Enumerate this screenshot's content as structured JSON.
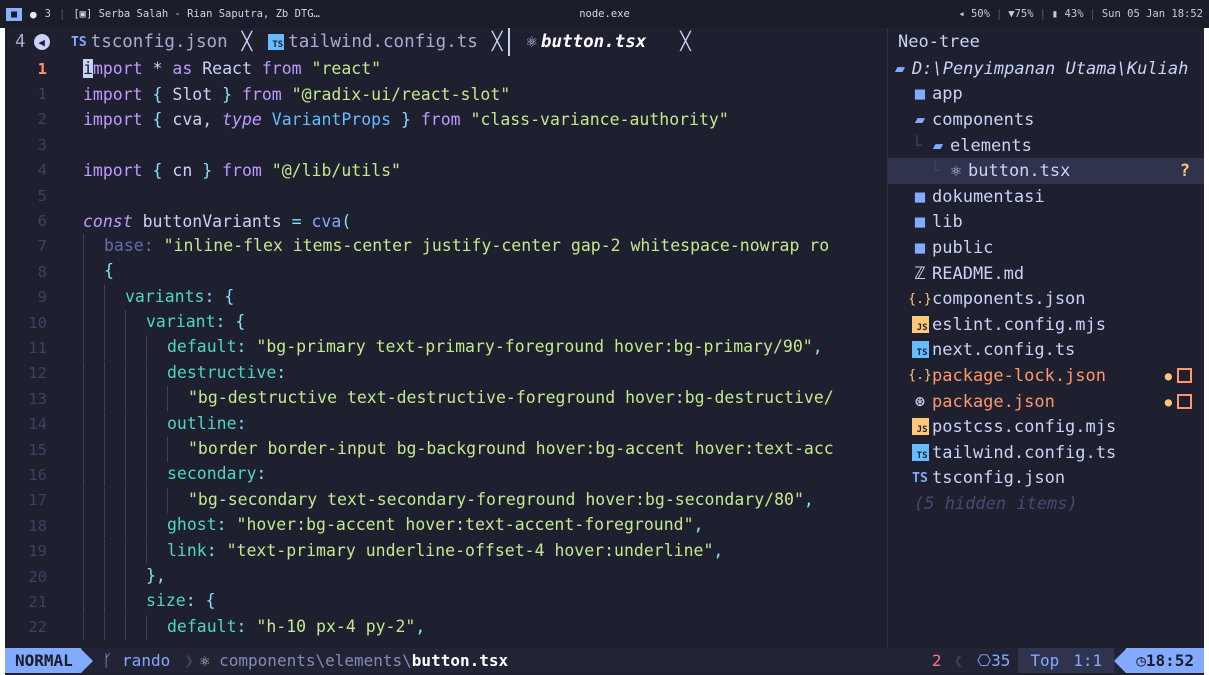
{
  "topbar": {
    "workspace_badge": "■",
    "circle": "●",
    "workspace_num": "3",
    "window_title": "[▣] Serba Salah - Rian Saputra, Zb DTG…",
    "center_title": "node.exe",
    "volume": "◂ 50%",
    "wifi": "▼75%",
    "battery": "▮ 43%",
    "datetime": "Sun 05 Jan 18:52"
  },
  "tabs": {
    "count": "4",
    "items": [
      {
        "icon": "TS",
        "label": "tsconfig.json",
        "close": "╳"
      },
      {
        "icon": "TS",
        "label": "tailwind.config.ts",
        "close": "╳"
      },
      {
        "icon": "⚛",
        "label": "button.tsx",
        "close": "╳"
      }
    ]
  },
  "editor": {
    "line_numbers": [
      "1",
      "1",
      "2",
      "3",
      "4",
      "5",
      "6",
      "7",
      "8",
      "9",
      "10",
      "11",
      "12",
      "13",
      "14",
      "15",
      "16",
      "17",
      "18",
      "19",
      "20",
      "21",
      "22"
    ],
    "lines": [
      {
        "c": "mport * as React from \"react\""
      },
      {
        "c": "import { Slot } from \"@radix-ui/react-slot\""
      },
      {
        "c": "import { cva, type VariantProps } from \"class-variance-authority\""
      },
      {
        "c": ""
      },
      {
        "c": "import { cn } from \"@/lib/utils\""
      },
      {
        "c": ""
      },
      {
        "c": "const buttonVariants = cva("
      },
      {
        "c": "\"inline-flex items-center justify-center gap-2 whitespace-nowrap ro"
      },
      {
        "c": "{"
      },
      {
        "c": "variants: {"
      },
      {
        "c": "variant: {"
      },
      {
        "c": "default: \"bg-primary text-primary-foreground hover:bg-primary/90\","
      },
      {
        "c": "destructive:"
      },
      {
        "c": "\"bg-destructive text-destructive-foreground hover:bg-destructive/"
      },
      {
        "c": "outline:"
      },
      {
        "c": "\"border border-input bg-background hover:bg-accent hover:text-acc"
      },
      {
        "c": "secondary:"
      },
      {
        "c": "\"bg-secondary text-secondary-foreground hover:bg-secondary/80\","
      },
      {
        "c": "ghost: \"hover:bg-accent hover:text-accent-foreground\","
      },
      {
        "c": "link: \"text-primary underline-offset-4 hover:underline\","
      },
      {
        "c": "},"
      },
      {
        "c": "size: {"
      },
      {
        "c": "default: \"h-10 px-4 py-2\","
      }
    ],
    "cursor_char": "i",
    "base_hint": "base:"
  },
  "tree": {
    "title": "Neo-tree",
    "root": "D:\\Penyimpanan Utama\\Kuliah",
    "items": [
      {
        "name": "app",
        "kind": "folder"
      },
      {
        "name": "components",
        "kind": "folder-open"
      },
      {
        "name": "elements",
        "kind": "folder-open"
      },
      {
        "name": "button.tsx",
        "kind": "react"
      },
      {
        "name": "dokumentasi",
        "kind": "folder"
      },
      {
        "name": "lib",
        "kind": "folder"
      },
      {
        "name": "public",
        "kind": "folder"
      },
      {
        "name": "README.md",
        "kind": "md"
      },
      {
        "name": "components.json",
        "kind": "json"
      },
      {
        "name": "eslint.config.mjs",
        "kind": "js"
      },
      {
        "name": "next.config.ts",
        "kind": "tsbox"
      },
      {
        "name": "package-lock.json",
        "kind": "json-mod"
      },
      {
        "name": "package.json",
        "kind": "npm-mod"
      },
      {
        "name": "postcss.config.mjs",
        "kind": "js"
      },
      {
        "name": "tailwind.config.ts",
        "kind": "tsbox"
      },
      {
        "name": "tsconfig.json",
        "kind": "ts"
      }
    ],
    "hidden": "(5 hidden items)",
    "unknown_mark": "?",
    "dot_mark": "●"
  },
  "statusline": {
    "mode": "NORMAL",
    "branch_icon": "ᚴ",
    "branch": "rando",
    "path_prefix": "components\\elements\\",
    "path_file": "button.tsx",
    "diag": "2",
    "lsp": "⎔35",
    "percent": "Top",
    "position": "1:1",
    "time": "◷18:52"
  },
  "colors": {
    "bg": "#1e2030",
    "accent": "#82aaff",
    "string": "#c3e88d",
    "keyword": "#c099ff",
    "modified": "#ff966c"
  }
}
